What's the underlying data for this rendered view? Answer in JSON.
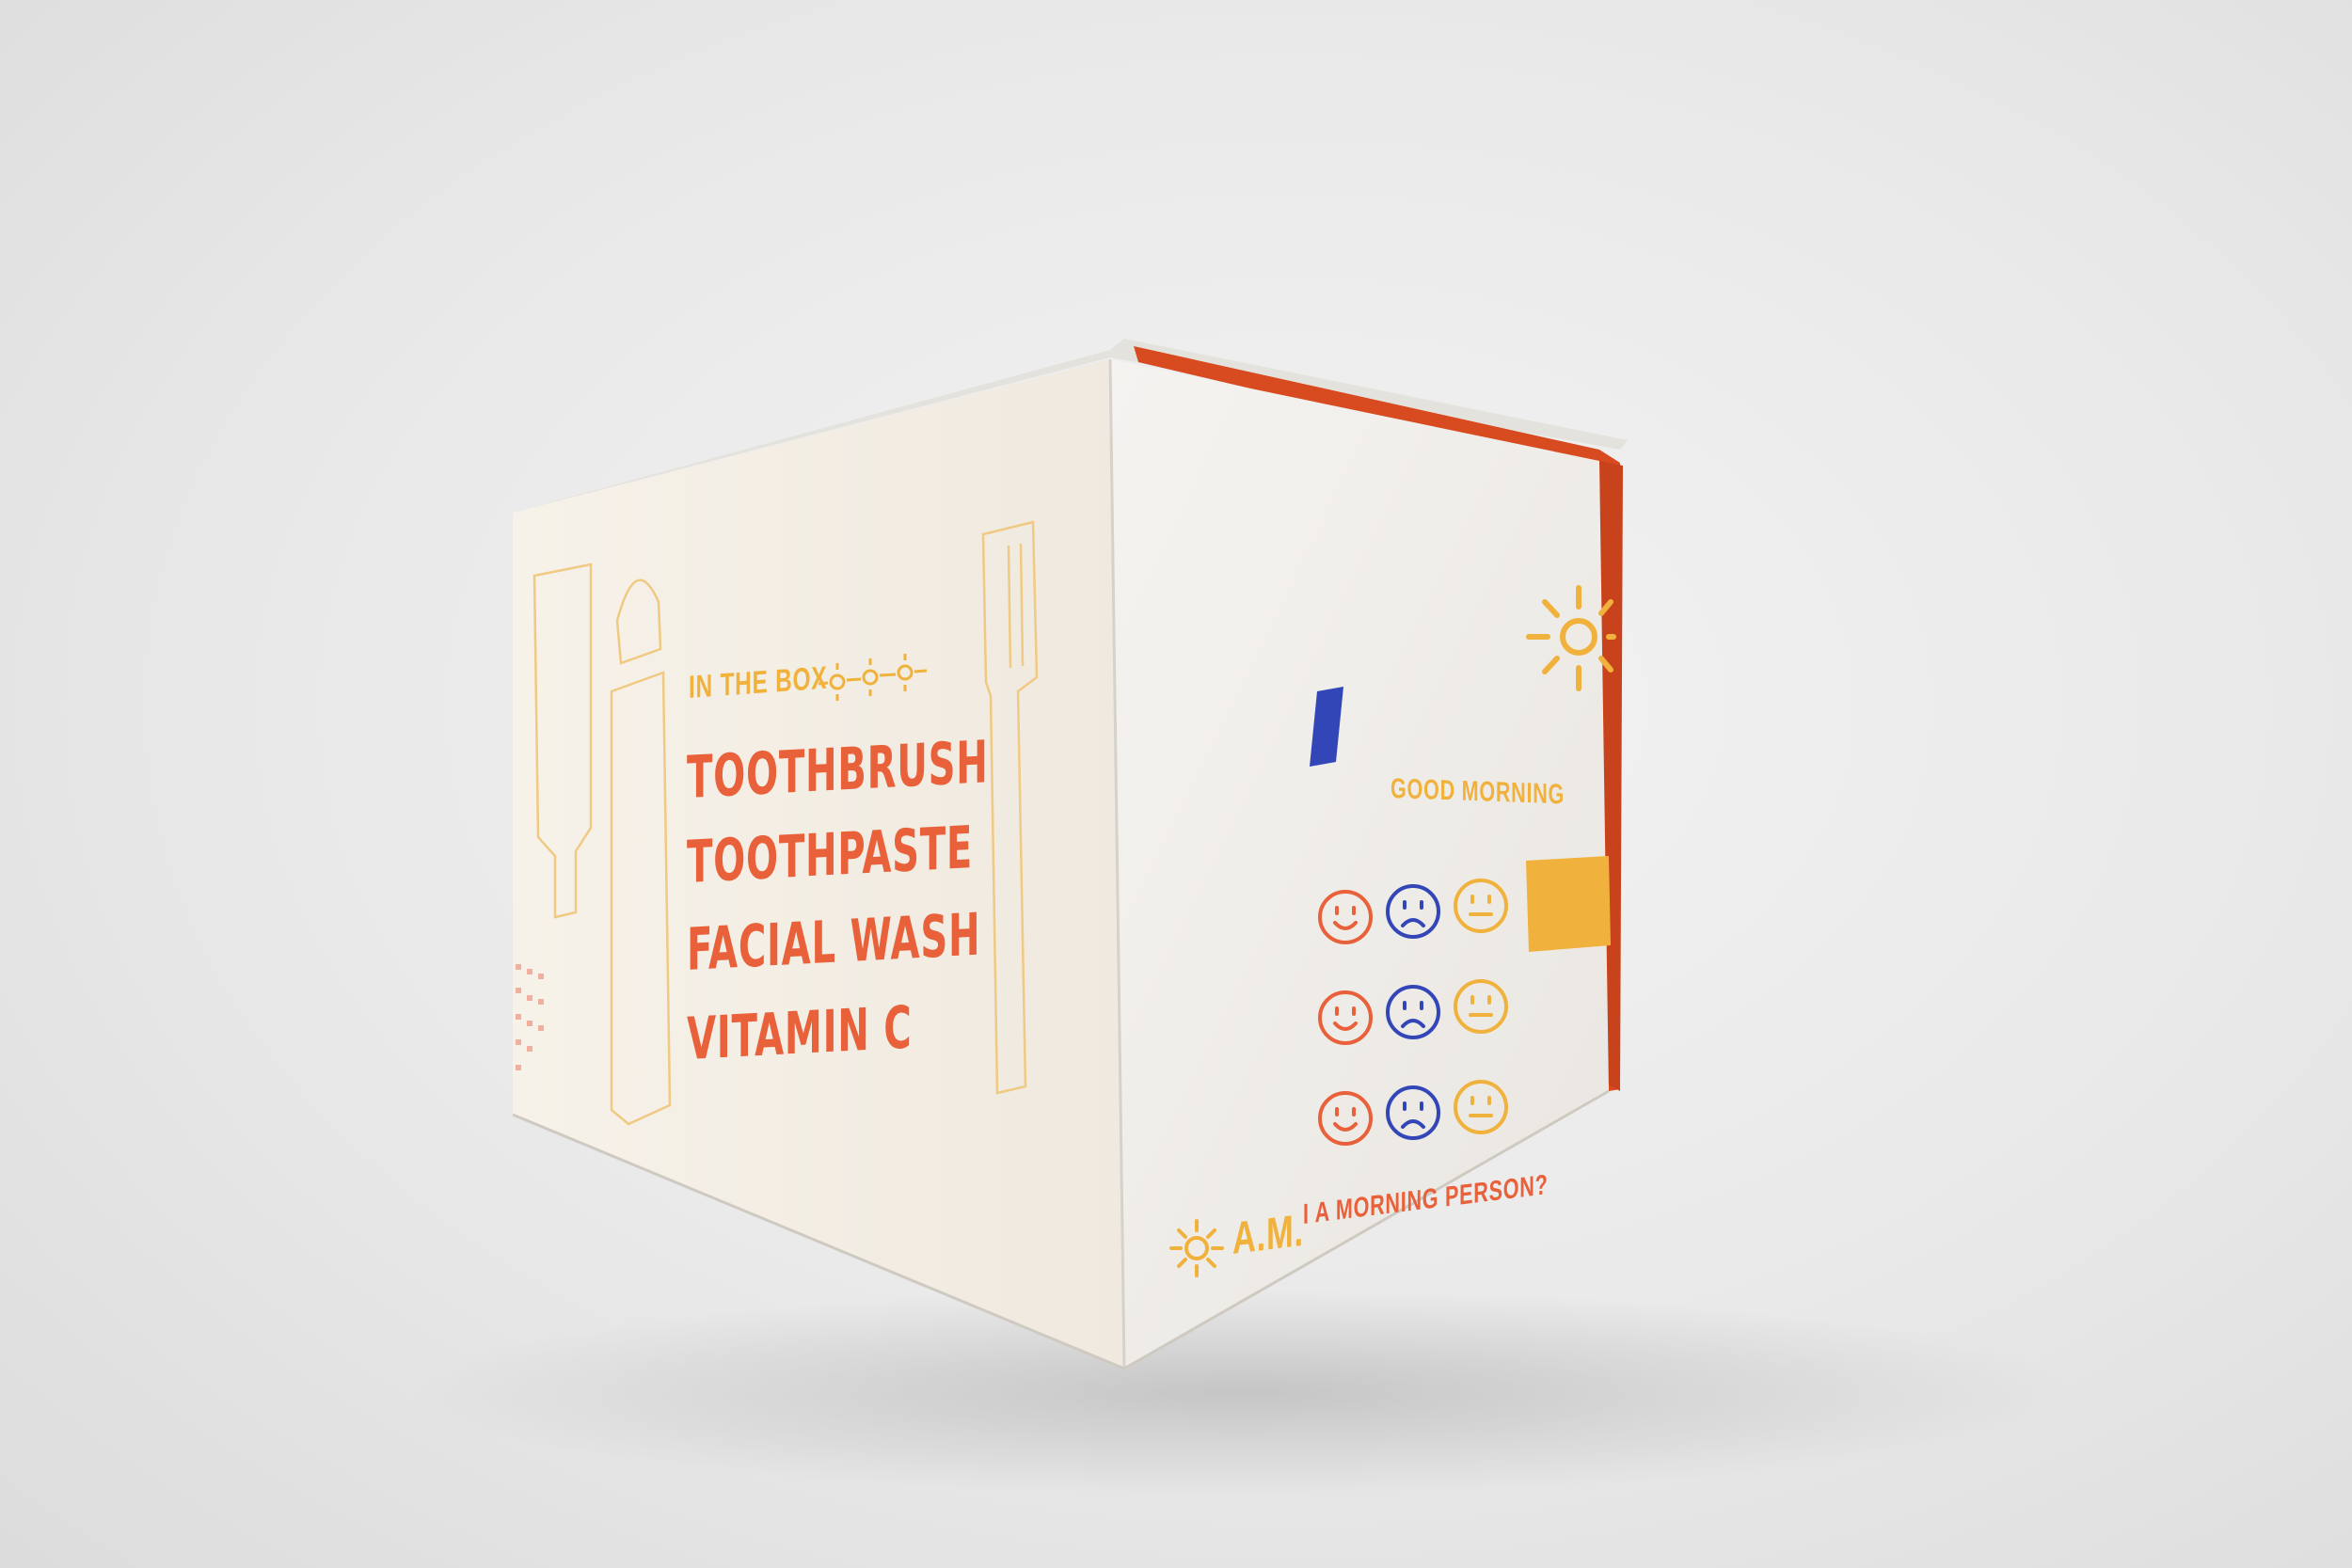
{
  "colors": {
    "background": "#eaeaea",
    "box_left": "#f4efe6",
    "box_right": "#f1efec",
    "orange": "#e8613a",
    "yellow": "#f0b23c",
    "blue": "#3346b8",
    "lid_orange": "#d84a1f"
  },
  "left_face": {
    "heading": "IN THE BOX",
    "items": [
      "TOOTHBRUSH",
      "TOOTHPASTE",
      "FACIAL WASH",
      "VITAMIN C"
    ]
  },
  "right_face": {
    "greeting": "GOOD MORNING",
    "brand": "A.M.",
    "tagline": "I A MORNING PERSON?",
    "faces": [
      [
        "smile",
        "sad",
        "neutral"
      ],
      [
        "smile",
        "sad",
        "neutral"
      ],
      [
        "smile",
        "sad",
        "neutral"
      ]
    ]
  }
}
